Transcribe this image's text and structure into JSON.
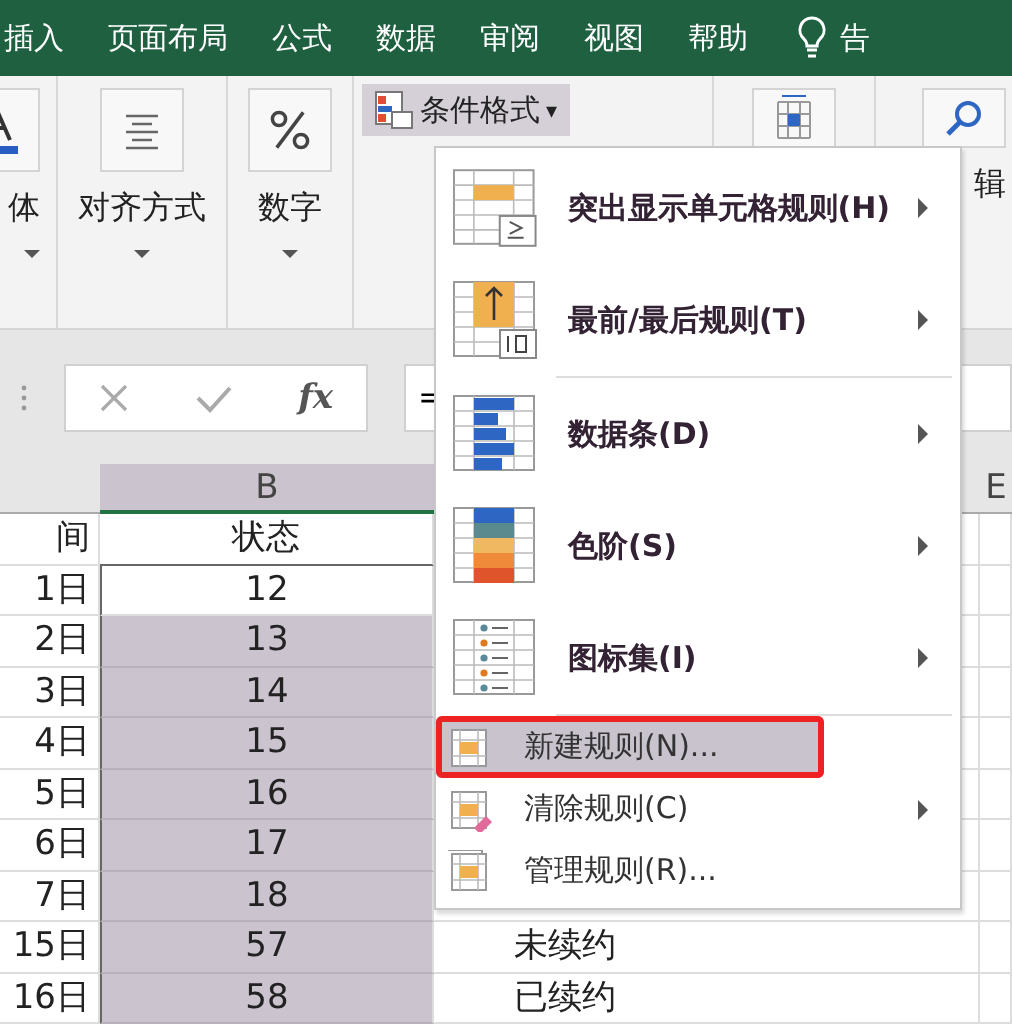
{
  "ribbon_tabs": [
    {
      "label": "插入",
      "kind": "tab"
    },
    {
      "label": "页面布局",
      "kind": "tab"
    },
    {
      "label": "公式",
      "kind": "tab"
    },
    {
      "label": "数据",
      "kind": "tab"
    },
    {
      "label": "审阅",
      "kind": "tab"
    },
    {
      "label": "视图",
      "kind": "tab"
    },
    {
      "label": "帮助",
      "kind": "tab"
    },
    {
      "label": "告",
      "kind": "tell"
    }
  ],
  "ribbon_groups": [
    {
      "label": "体"
    },
    {
      "label": "对齐方式"
    },
    {
      "label": "数字"
    }
  ],
  "conditional_format_button": {
    "label": "条件格式",
    "caret": "▾",
    "pressed": true
  },
  "edit_group": {
    "label": "辑"
  },
  "formula_bar": {
    "fx": "fx",
    "value": "="
  },
  "columns": [
    {
      "label": "B",
      "selected": true
    },
    {
      "label": "E",
      "selected": false
    }
  ],
  "rows": [
    {
      "a": "间",
      "b": "状态",
      "b_selected": false,
      "kind": "header"
    },
    {
      "a": "1日",
      "b": "12",
      "b_selected": false,
      "kind": "data"
    },
    {
      "a": "2日",
      "b": "13",
      "b_selected": true,
      "kind": "data"
    },
    {
      "a": "3日",
      "b": "14",
      "b_selected": true,
      "kind": "data"
    },
    {
      "a": "4日",
      "b": "15",
      "b_selected": true,
      "kind": "data"
    },
    {
      "a": "5日",
      "b": "16",
      "b_selected": true,
      "kind": "data"
    },
    {
      "a": "6日",
      "b": "17",
      "b_selected": true,
      "kind": "data"
    },
    {
      "a": "7日",
      "b": "18",
      "b_selected": true,
      "kind": "data"
    },
    {
      "a": "15日",
      "b": "57",
      "b_selected": true,
      "c": "未续约",
      "kind": "data"
    },
    {
      "a": "16日",
      "b": "58",
      "b_selected": true,
      "c": "已续约",
      "kind": "data"
    }
  ],
  "menu": [
    {
      "label": "突出显示单元格规则(H)",
      "kind": "gallery",
      "submenu": true,
      "selected": false
    },
    {
      "label": "最前/最后规则(T)",
      "kind": "gallery",
      "submenu": true,
      "selected": false
    },
    {
      "label": "数据条(D)",
      "kind": "gallery",
      "submenu": true,
      "selected": false
    },
    {
      "label": "色阶(S)",
      "kind": "gallery",
      "submenu": true,
      "selected": false
    },
    {
      "label": "图标集(I)",
      "kind": "gallery",
      "submenu": true,
      "selected": false
    },
    {
      "label": "新建规则(N)...",
      "kind": "command",
      "submenu": false,
      "selected": true
    },
    {
      "label": "清除规则(C)",
      "kind": "command",
      "submenu": true,
      "selected": false
    },
    {
      "label": "管理规则(R)...",
      "kind": "command",
      "submenu": false,
      "selected": false
    }
  ]
}
